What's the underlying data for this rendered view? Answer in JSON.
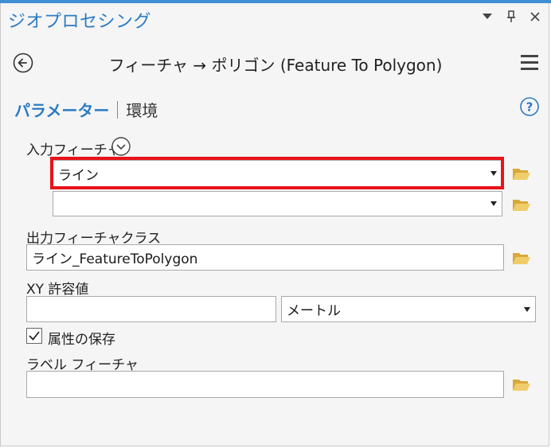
{
  "pane": {
    "title": "ジオプロセシング"
  },
  "tool": {
    "title": "フィーチャ → ポリゴン (Feature To Polygon)"
  },
  "tabs": {
    "parameters": "パラメーター",
    "environments": "環境"
  },
  "params": {
    "input_label": "入力フィーチャ",
    "input_value": "ライン",
    "input_value2": "",
    "output_label": "出力フィーチャクラス",
    "output_value": "ライン_FeatureToPolygon",
    "xy_label": "XY 許容値",
    "xy_value": "",
    "xy_unit": "メートル",
    "preserve_label": "属性の保存",
    "preserve_checked": true,
    "label_features_label": "ラベル フィーチャ",
    "label_features_value": ""
  },
  "colors": {
    "accent": "#2b7bc4",
    "highlight": "#e8131b",
    "folder": "#e8c25a"
  }
}
